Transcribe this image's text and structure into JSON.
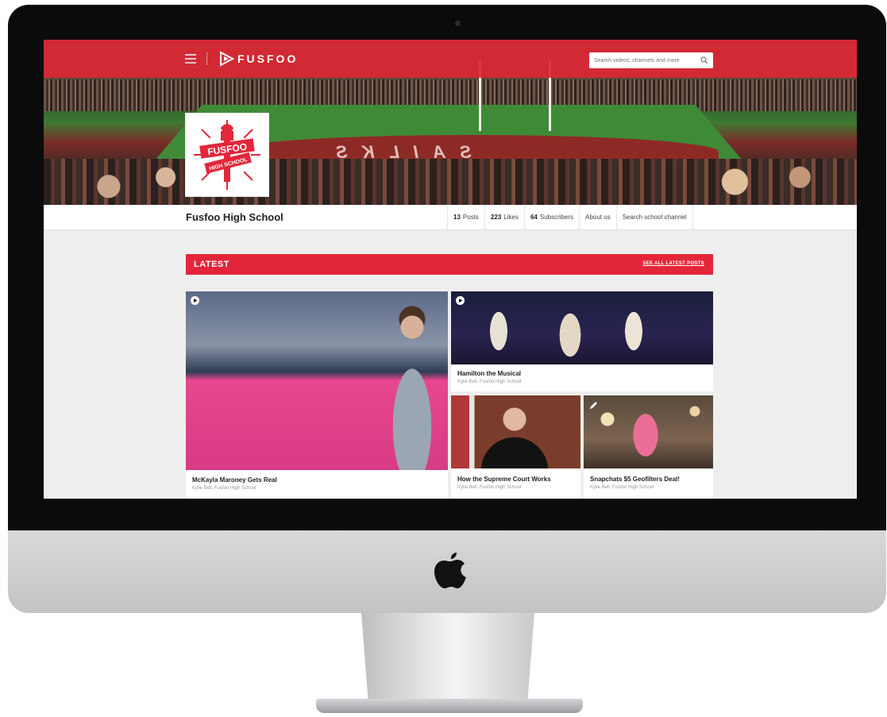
{
  "site": {
    "brand_name": "FUSFOO",
    "search_placeholder": "Search videos, channels and more",
    "accent_color": "#e3263a"
  },
  "school": {
    "name": "Fusfoo High School",
    "logo_text_top": "FUSFOO",
    "logo_text_bottom": "HIGH SCHOOL",
    "hero_endzone_text": "SAILKS"
  },
  "stats": [
    {
      "count": "13",
      "label": "Posts"
    },
    {
      "count": "223",
      "label": "Likes"
    },
    {
      "count": "64",
      "label": "Subscribers"
    },
    {
      "count": "",
      "label": "About us"
    },
    {
      "count": "",
      "label": "Search school channel"
    }
  ],
  "latest": {
    "title": "LATEST",
    "see_all": "SEE ALL LATEST POSTS"
  },
  "posts": [
    {
      "title": "McKayla Maroney Gets Real",
      "meta": "Kylie Bell, Fusfoo High School",
      "icon": "play-icon"
    },
    {
      "title": "Hamilton the Musical",
      "meta": "Kylie Bell, Fusfoo High School",
      "icon": "play-icon"
    },
    {
      "title": "How the Supreme Court Works",
      "meta": "Kylie Bell, Fusfoo High School",
      "icon": ""
    },
    {
      "title": "Snapchats $5 Geofilters Deal!",
      "meta": "Kylie Bell, Fusfoo High School",
      "icon": "pencil-icon"
    }
  ]
}
